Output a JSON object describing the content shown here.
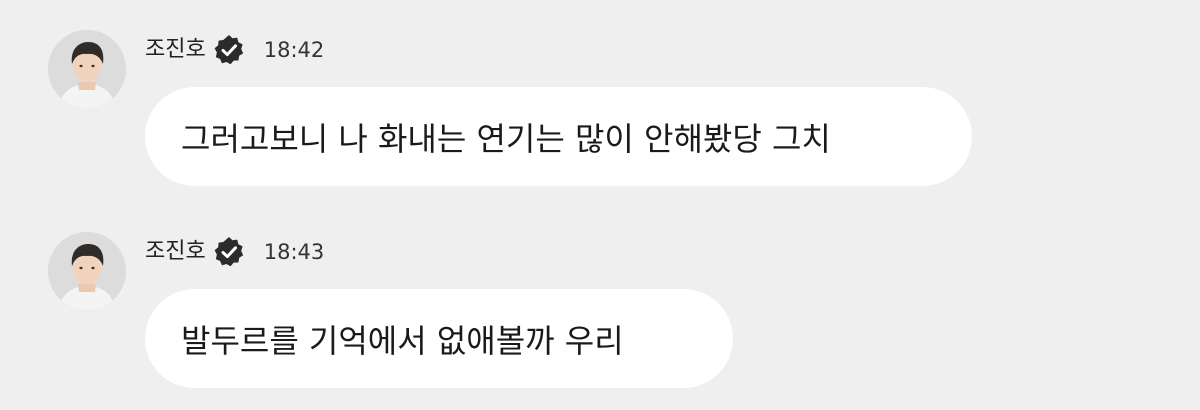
{
  "messages": [
    {
      "sender": "조진호",
      "time": "18:42",
      "text": "그러고보니 나 화내는 연기는 많이 안해봤당 그치"
    },
    {
      "sender": "조진호",
      "time": "18:43",
      "text": "발두르를 기억에서 없애볼까 우리"
    }
  ],
  "icons": {
    "verified": "verified-badge-icon",
    "avatar": "profile-photo"
  },
  "colors": {
    "background": "#efeff0",
    "bubble": "#ffffff",
    "badge": "#2b2b2b"
  }
}
